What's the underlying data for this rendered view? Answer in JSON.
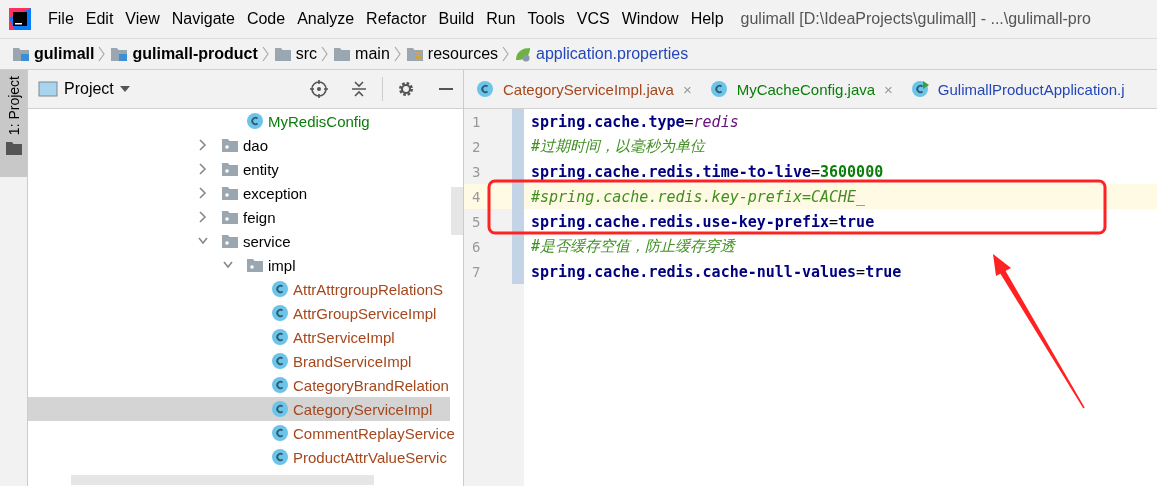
{
  "menu_bar": {
    "items": [
      "File",
      "Edit",
      "View",
      "Navigate",
      "Code",
      "Analyze",
      "Refactor",
      "Build",
      "Run",
      "Tools",
      "VCS",
      "Window",
      "Help"
    ],
    "title": "gulimall [D:\\IdeaProjects\\gulimall] - ...\\gulimall-pro"
  },
  "breadcrumb": [
    {
      "label": "gulimall",
      "kind": "module"
    },
    {
      "label": "gulimall-product",
      "kind": "module"
    },
    {
      "label": "src",
      "kind": "folder"
    },
    {
      "label": "main",
      "kind": "folder"
    },
    {
      "label": "resources",
      "kind": "resources"
    },
    {
      "label": "application.properties",
      "kind": "properties"
    }
  ],
  "tool_stripe": {
    "label": "1: Project"
  },
  "project_panel": {
    "title": "Project",
    "tree": [
      {
        "children": [
          {
            "label": "MyRedisConfig",
            "kind": "class",
            "color": "#0a7d0a",
            "selected": false
          }
        ]
      },
      {
        "label": "dao",
        "kind": "package",
        "expanded": false,
        "selected": false
      },
      {
        "label": "entity",
        "kind": "package",
        "expanded": false,
        "selected": false
      },
      {
        "label": "exception",
        "kind": "package",
        "expanded": false,
        "selected": false
      },
      {
        "label": "feign",
        "kind": "package",
        "expanded": false,
        "selected": false
      },
      {
        "label": "service",
        "kind": "package",
        "expanded": true,
        "selected": false,
        "children": [
          {
            "label": "impl",
            "kind": "package",
            "expanded": true,
            "selected": false,
            "children": [
              {
                "label": "AttrAttrgroupRelationS",
                "kind": "class",
                "color": "#a5471d",
                "selected": false
              },
              {
                "label": "AttrGroupServiceImpl",
                "kind": "class",
                "color": "#a5471d",
                "selected": false
              },
              {
                "label": "AttrServiceImpl",
                "kind": "class",
                "color": "#a5471d",
                "selected": false
              },
              {
                "label": "BrandServiceImpl",
                "kind": "class",
                "color": "#a5471d",
                "selected": false
              },
              {
                "label": "CategoryBrandRelation",
                "kind": "class",
                "color": "#a5471d",
                "selected": false
              },
              {
                "label": "CategoryServiceImpl",
                "kind": "class",
                "color": "#a5471d",
                "selected": true
              },
              {
                "label": "CommentReplayService",
                "kind": "class",
                "color": "#a5471d",
                "selected": false
              },
              {
                "label": "ProductAttrValueServic",
                "kind": "class",
                "color": "#a5471d",
                "selected": false
              }
            ]
          }
        ]
      }
    ]
  },
  "editor": {
    "tabs": [
      {
        "label": "CategoryServiceImpl.java",
        "kind": "class",
        "color": "#a5471d",
        "close": "×"
      },
      {
        "label": "MyCacheConfig.java",
        "kind": "class",
        "color": "#0a7d0a",
        "close": "×"
      },
      {
        "label": "GulimallProductApplication.j",
        "kind": "run-class",
        "color": "#2447b8"
      }
    ],
    "lines": [
      {
        "number": "1",
        "current": false,
        "tokens": [
          {
            "text": "spring.cache.type",
            "kind": "key"
          },
          {
            "text": "=",
            "kind": "op"
          },
          {
            "text": "redis",
            "kind": "value"
          }
        ]
      },
      {
        "number": "2",
        "current": false,
        "tokens": [
          {
            "text": "#过期时间，以毫秒为单位",
            "kind": "comment"
          }
        ]
      },
      {
        "number": "3",
        "current": false,
        "tokens": [
          {
            "text": "spring.cache.redis.time-to-live",
            "kind": "key"
          },
          {
            "text": "=",
            "kind": "op"
          },
          {
            "text": "3600000",
            "kind": "number"
          }
        ]
      },
      {
        "number": "4",
        "current": true,
        "tokens": [
          {
            "text": "#spring.cache.redis.key-prefix=CACHE_",
            "kind": "comment"
          }
        ]
      },
      {
        "number": "5",
        "current": false,
        "tokens": [
          {
            "text": "spring.cache.redis.use-key-prefix",
            "kind": "key"
          },
          {
            "text": "=",
            "kind": "op"
          },
          {
            "text": "true",
            "kind": "key"
          }
        ]
      },
      {
        "number": "6",
        "current": false,
        "tokens": [
          {
            "text": "#是否缓存空值，防止缓存穿透",
            "kind": "comment"
          }
        ]
      },
      {
        "number": "7",
        "current": false,
        "tokens": [
          {
            "text": "spring.cache.redis.cache-null-values",
            "kind": "key"
          },
          {
            "text": "=",
            "kind": "op"
          },
          {
            "text": "true",
            "kind": "key"
          }
        ]
      }
    ]
  }
}
